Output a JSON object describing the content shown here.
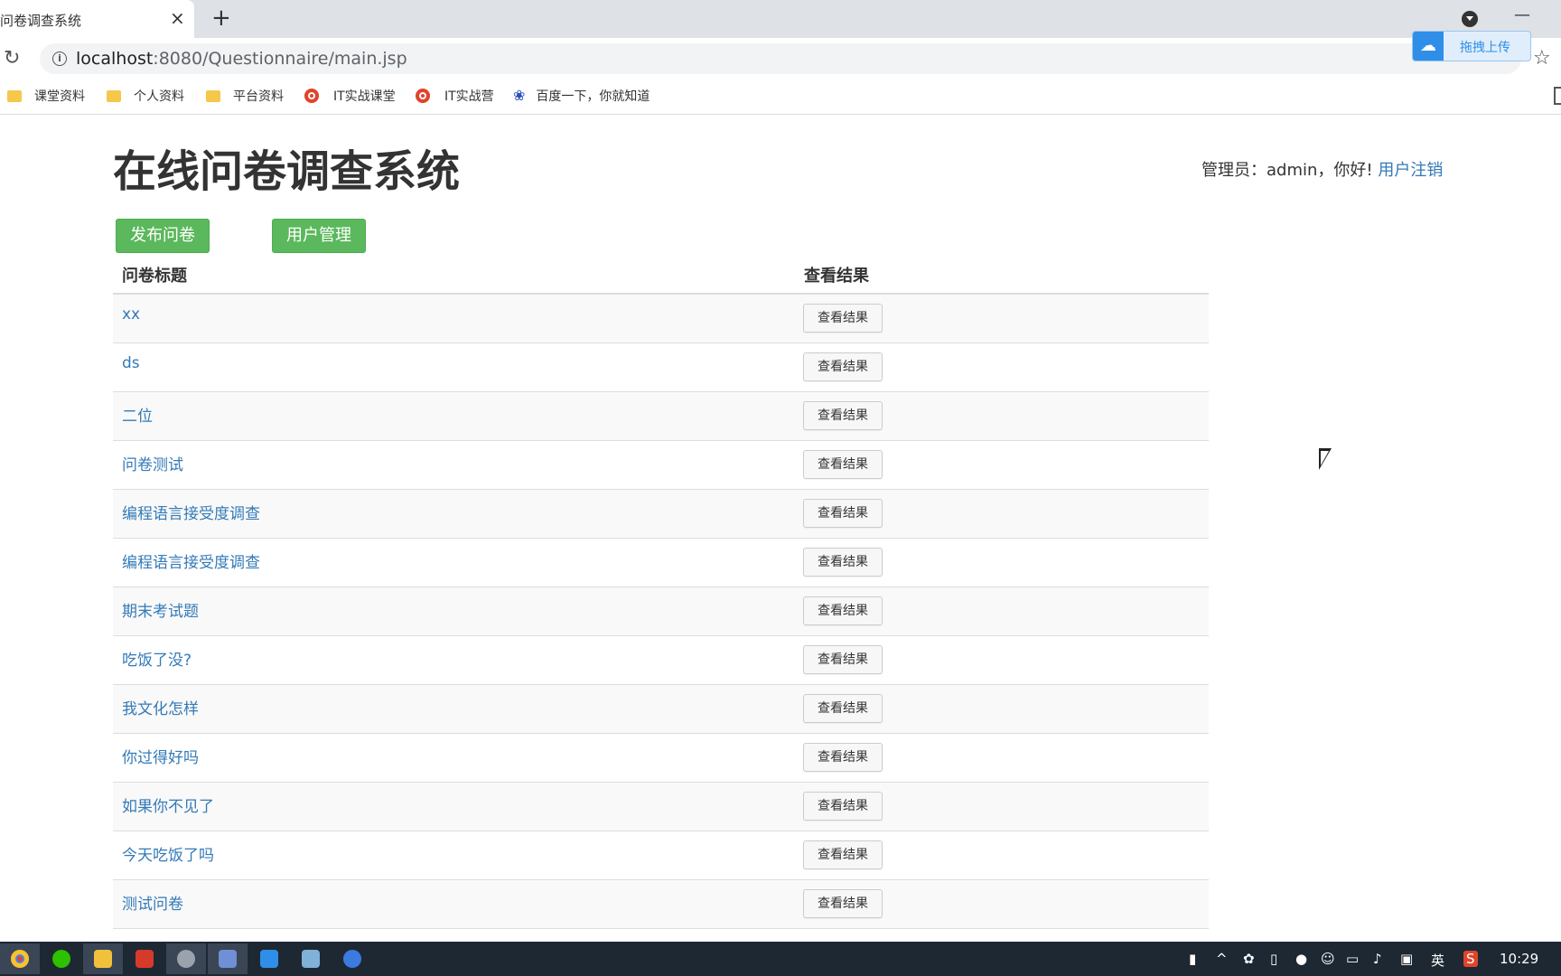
{
  "browser": {
    "tab_title": "问卷调查系统",
    "tab_close": "×",
    "new_tab": "+",
    "url_host": "localhost",
    "url_rest": ":8080/Questionnaire/main.jsp",
    "upload_label": "拖拽上传",
    "bookmarks": [
      {
        "label": "课堂资料",
        "icon": "folder-icon"
      },
      {
        "label": "个人资料",
        "icon": "folder-icon"
      },
      {
        "label": "平台资料",
        "icon": "folder-icon"
      },
      {
        "label": "IT实战课堂",
        "icon": "chrome-icon"
      },
      {
        "label": "IT实战营",
        "icon": "chrome-icon"
      },
      {
        "label": "百度一下，你就知道",
        "icon": "baidu-paw-icon"
      }
    ]
  },
  "page": {
    "title": "在线问卷调查系统",
    "user_greeting": "管理员：admin，你好! ",
    "logout_label": "用户注销",
    "publish_button": "发布问卷",
    "users_button": "用户管理"
  },
  "table": {
    "col_title": "问卷标题",
    "col_result": "查看结果",
    "button_label": "查看结果",
    "rows": [
      {
        "title": "xx"
      },
      {
        "title": "ds"
      },
      {
        "title": "二位"
      },
      {
        "title": "问卷测试"
      },
      {
        "title": "编程语言接受度调查"
      },
      {
        "title": "编程语言接受度调查"
      },
      {
        "title": "期末考试题"
      },
      {
        "title": "吃饭了没?"
      },
      {
        "title": "我文化怎样"
      },
      {
        "title": "你过得好吗"
      },
      {
        "title": "如果你不见了"
      },
      {
        "title": "今天吃饭了吗"
      },
      {
        "title": "测试问卷"
      }
    ]
  },
  "taskbar": {
    "ime": "英",
    "clock": "10:29"
  },
  "colors": {
    "accent_green": "#5cb85c",
    "link_blue": "#337ab7",
    "taskbar": "#1e2833"
  }
}
